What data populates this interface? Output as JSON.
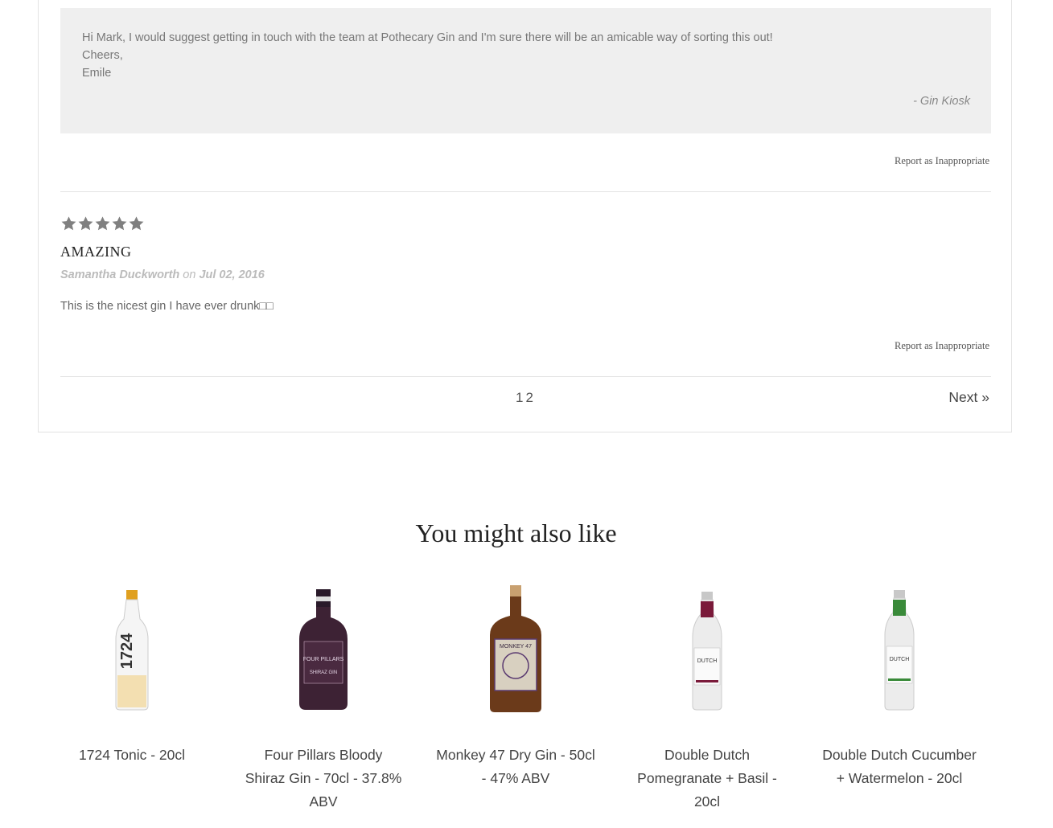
{
  "reply": {
    "body": "Hi Mark, I would suggest getting in touch with the team at Pothecary Gin and I'm sure there will be an amicable way of sorting this out!\nCheers,\nEmile",
    "signature": "- Gin Kiosk"
  },
  "report_label": "Report as Inappropriate",
  "review": {
    "rating": 5,
    "title": "AMAZING",
    "author": "Samantha Duckworth",
    "on_label": "on",
    "date": "Jul 02, 2016",
    "body": "This is the nicest gin I have ever drunk□□"
  },
  "pagination": {
    "pages": [
      "1",
      "2"
    ],
    "next_label": "Next »"
  },
  "related": {
    "title": "You might also like",
    "products": [
      {
        "name": "1724 Tonic - 20cl"
      },
      {
        "name": "Four Pillars Bloody Shiraz Gin - 70cl - 37.8% ABV"
      },
      {
        "name": "Monkey 47 Dry Gin - 50cl - 47% ABV"
      },
      {
        "name": "Double Dutch Pomegranate + Basil - 20cl"
      },
      {
        "name": "Double Dutch Cucumber + Watermelon - 20cl"
      }
    ]
  },
  "colors": {
    "reply_bg": "#efefef",
    "star": "#808080"
  }
}
